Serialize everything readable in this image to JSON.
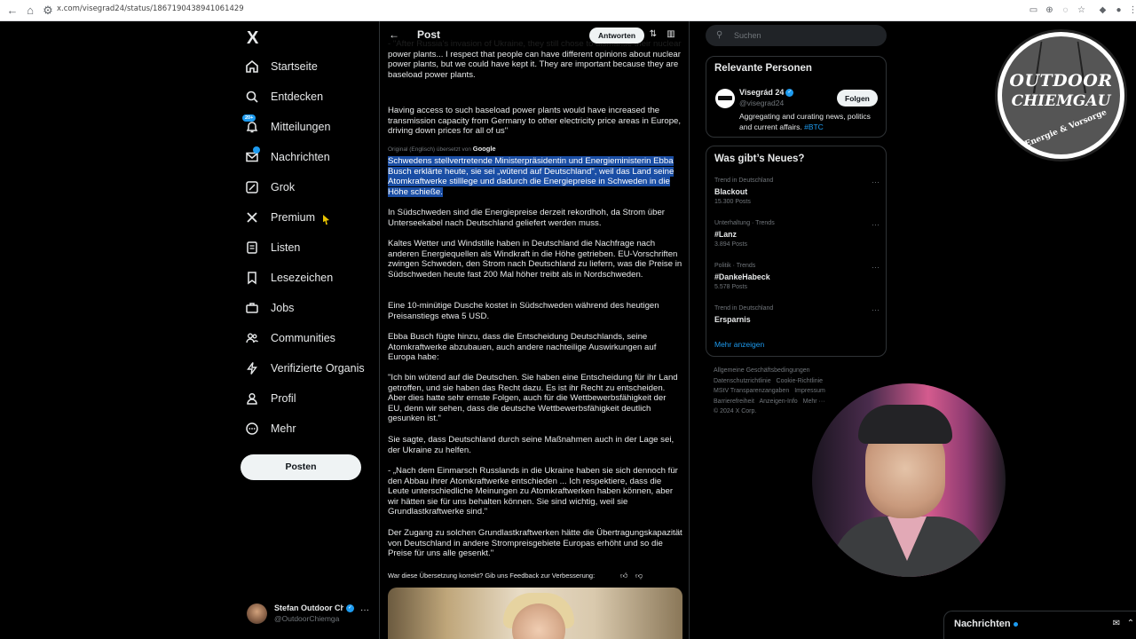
{
  "browser": {
    "url": "x.com/visegrad24/status/1867190438941061429"
  },
  "nav": {
    "logo": "X",
    "items": [
      {
        "label": "Startseite",
        "icon": "home-icon"
      },
      {
        "label": "Entdecken",
        "icon": "search-icon"
      },
      {
        "label": "Mitteilungen",
        "icon": "bell-icon",
        "badge": "20+"
      },
      {
        "label": "Nachrichten",
        "icon": "mail-icon"
      },
      {
        "label": "Grok",
        "icon": "grok-icon"
      },
      {
        "label": "Premium",
        "icon": "x-logo-icon"
      },
      {
        "label": "Listen",
        "icon": "list-icon"
      },
      {
        "label": "Lesezeichen",
        "icon": "bookmark-icon"
      },
      {
        "label": "Jobs",
        "icon": "briefcase-icon"
      },
      {
        "label": "Communities",
        "icon": "people-icon"
      },
      {
        "label": "Verifizierte Organis",
        "icon": "lightning-icon"
      },
      {
        "label": "Profil",
        "icon": "person-icon"
      },
      {
        "label": "Mehr",
        "icon": "more-circle-icon"
      }
    ],
    "post_button": "Posten",
    "account": {
      "name": "Stefan Outdoor Ch",
      "handle": "@OutdoorChiemga"
    }
  },
  "post": {
    "header_title": "Post",
    "reply_button": "Antworten",
    "p_top": "- \"After Russia's invasion of Ukraine, they still chose to dismantle their nuclear power plants... I respect that people can have different opinions about nuclear power plants, but we could have kept it. They are important because they are baseload power plants.",
    "p_access": "Having access to such baseload power plants would have increased the transmission capacity from Germany to other electricity price areas in Europe, driving down prices for all of us\"",
    "translated_by": "Original (Englisch) übersetzt von",
    "google": "Google",
    "p_highlight": "Schwedens stellvertretende Ministerpräsidentin und Energieministerin Ebba Busch erklärte heute, sie sei „wütend auf Deutschland\", weil das Land seine Atomkraftwerke stilllege und dadurch die Energiepreise in Schweden in die Höhe schieße.",
    "p2": "In Südschweden sind die Energiepreise derzeit rekordhoh, da Strom über Unterseekabel nach Deutschland geliefert werden muss.",
    "p3": "Kaltes Wetter und Windstille haben in Deutschland die Nachfrage nach anderen Energiequellen als Windkraft in die Höhe getrieben. EU-Vorschriften zwingen Schweden, den Strom nach Deutschland zu liefern, was die Preise in Südschweden heute fast 200 Mal höher treibt als in Nordschweden.",
    "p4": "Eine 10-minütige Dusche kostet in Südschweden während des heutigen Preisanstiegs etwa 5 USD.",
    "p5": "Ebba Busch fügte hinzu, dass die Entscheidung Deutschlands, seine Atomkraftwerke abzubauen, auch andere nachteilige Auswirkungen auf Europa habe:",
    "p6": "\"Ich bin wütend auf die Deutschen. Sie haben eine Entscheidung für ihr Land getroffen, und sie haben das Recht dazu. Es ist ihr Recht zu entscheiden. Aber dies hatte sehr ernste Folgen, auch für die Wettbewerbsfähigkeit der EU, denn wir sehen, dass die deutsche Wettbewerbsfähigkeit deutlich gesunken ist.\"",
    "p7": "Sie sagte, dass Deutschland durch seine Maßnahmen auch in der Lage sei, der Ukraine zu helfen.",
    "p8": "- „Nach dem Einmarsch Russlands in die Ukraine haben sie sich dennoch für den Abbau ihrer Atomkraftwerke entschieden ... Ich respektiere, dass die Leute unterschiedliche Meinungen zu Atomkraftwerken haben können, aber wir hätten sie für uns behalten können. Sie sind wichtig, weil sie Grundlastkraftwerke sind.\"",
    "p9": "Der Zugang zu solchen Grundlastkraftwerken hätte die Übertragungskapazität von Deutschland in andere Strompreisgebiete Europas erhöht und so die Preise für uns alle gesenkt.\"",
    "feedback": "War diese Übersetzung korrekt? Gib uns Feedback zur Verbesserung:"
  },
  "right": {
    "search_placeholder": "Suchen",
    "people_title": "Relevante Personen",
    "person": {
      "name": "Visegrád 24",
      "handle": "@visegrad24",
      "follow": "Folgen",
      "bio": "Aggregating and curating news, politics and current affairs.",
      "bio_link": "#BTC"
    },
    "trends_title": "Was gibt’s Neues?",
    "trends": [
      {
        "category": "Trend in Deutschland",
        "name": "Blackout",
        "count": "15.300 Posts"
      },
      {
        "category": "Unterhaltung · Trends",
        "name": "#Lanz",
        "count": "3.894 Posts"
      },
      {
        "category": "Politik · Trends",
        "name": "#DankeHabeck",
        "count": "5.578 Posts"
      },
      {
        "category": "Trend in Deutschland",
        "name": "Ersparnis",
        "count": ""
      }
    ],
    "show_more": "Mehr anzeigen",
    "footer": [
      "Allgemeine Geschäftsbedingungen",
      "Datenschutzrichtlinie",
      "Cookie-Richtlinie",
      "MStV Transparenzangaben",
      "Impressum",
      "Barrierefreiheit",
      "Anzeigen-Info",
      "Mehr ···",
      "© 2024 X Corp."
    ]
  },
  "overlay": {
    "logo_line1": "OUTDOOR",
    "logo_line2": "CHIEMGAU",
    "logo_line3": "Energie & Vorsorge",
    "messages_bar": "Nachrichten"
  },
  "colors": {
    "accent": "#1d9bf0",
    "background": "#000000",
    "border": "#2f3336",
    "highlight": "#1a4ea5"
  }
}
